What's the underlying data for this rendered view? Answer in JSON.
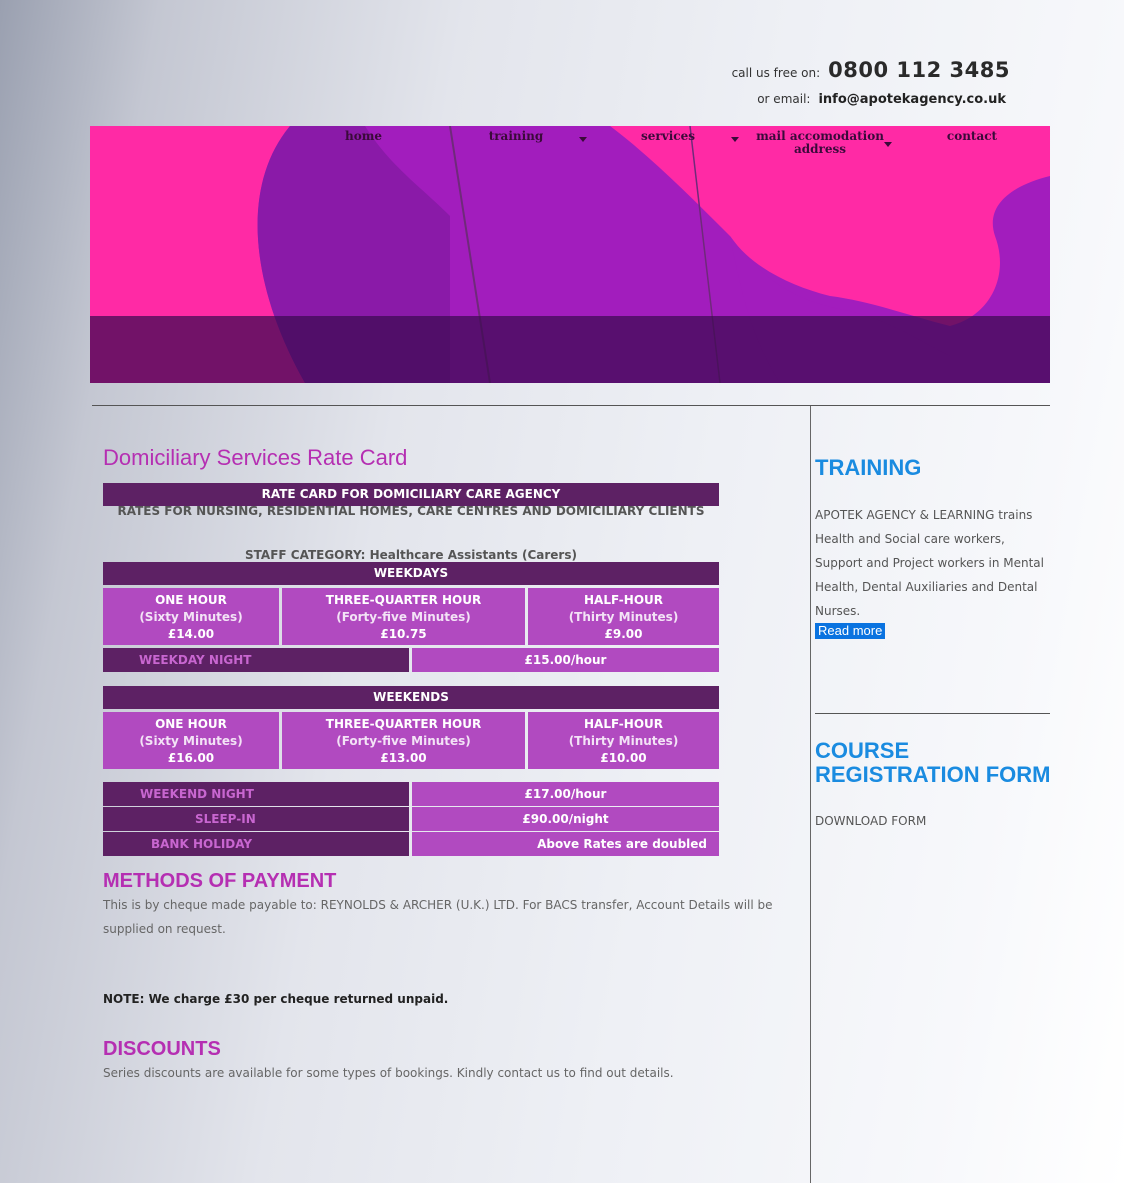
{
  "header": {
    "call_label": "call us free on:",
    "phone": "0800 112 3485",
    "email_label": "or email:",
    "email": "info@apotekagency.co.uk"
  },
  "nav": {
    "home": "home",
    "training": "training",
    "services": "services",
    "mail_line1": "mail accomodation",
    "mail_line2": "address",
    "contact": "contact"
  },
  "main": {
    "title": "Domiciliary Services Rate Card",
    "rate_card": {
      "heading": "RATE CARD FOR DOMICILIARY CARE AGENCY",
      "subheading": "RATES FOR NURSING, RESIDENTIAL HOMES, CARE CENTRES AND DOMICILIARY CLIENTS",
      "staff_category": "STAFF CATEGORY: Healthcare Assistants (Carers)",
      "weekdays": {
        "label": "WEEKDAYS",
        "cols": [
          {
            "title": "ONE HOUR",
            "sub": "(Sixty Minutes)",
            "price": "£14.00"
          },
          {
            "title": "THREE-QUARTER HOUR",
            "sub": "(Forty-five Minutes)",
            "price": "£10.75"
          },
          {
            "title": "HALF-HOUR",
            "sub": "(Thirty Minutes)",
            "price": "£9.00"
          }
        ],
        "night_label": "WEEKDAY NIGHT",
        "night_price": "£15.00/hour"
      },
      "weekends": {
        "label": "WEEKENDS",
        "cols": [
          {
            "title": "ONE HOUR",
            "sub": "(Sixty Minutes)",
            "price": "£16.00"
          },
          {
            "title": "THREE-QUARTER HOUR",
            "sub": "(Forty-five Minutes)",
            "price": "£13.00"
          },
          {
            "title": "HALF-HOUR",
            "sub": "(Thirty Minutes)",
            "price": "£10.00"
          }
        ]
      },
      "extras": [
        {
          "label": "WEEKEND NIGHT",
          "value": "£17.00/hour"
        },
        {
          "label": "SLEEP-IN",
          "value": "£90.00/night"
        },
        {
          "label": "BANK HOLIDAY",
          "value": "Above Rates are doubled"
        }
      ]
    },
    "payment": {
      "heading": "METHODS OF PAYMENT",
      "text": "This is by cheque made payable to: REYNOLDS & ARCHER (U.K.) LTD. For BACS transfer, Account Details will be supplied on request.",
      "note": "NOTE: We charge £30 per cheque returned unpaid."
    },
    "discounts": {
      "heading": "DISCOUNTS",
      "text": "Series discounts are available for some types of bookings. Kindly contact us to find out details."
    }
  },
  "sidebar": {
    "training_heading": "TRAINING",
    "training_text": "APOTEK AGENCY & LEARNING trains Health and Social care workers, Support and Project workers in Mental Health, Dental Auxiliaries and Dental Nurses.",
    "read_more": "Read more",
    "course_line1": "COURSE",
    "course_line2": "REGISTRATION FORM",
    "download": "DOWNLOAD FORM"
  },
  "colors": {
    "accent_magenta": "#b52fb2",
    "dark_purple": "#5d2164",
    "cell_purple": "#b14ac0",
    "banner_pink": "#ff2aa5",
    "sidebar_blue": "#1a8be0",
    "link_bg": "#0a73e0"
  }
}
